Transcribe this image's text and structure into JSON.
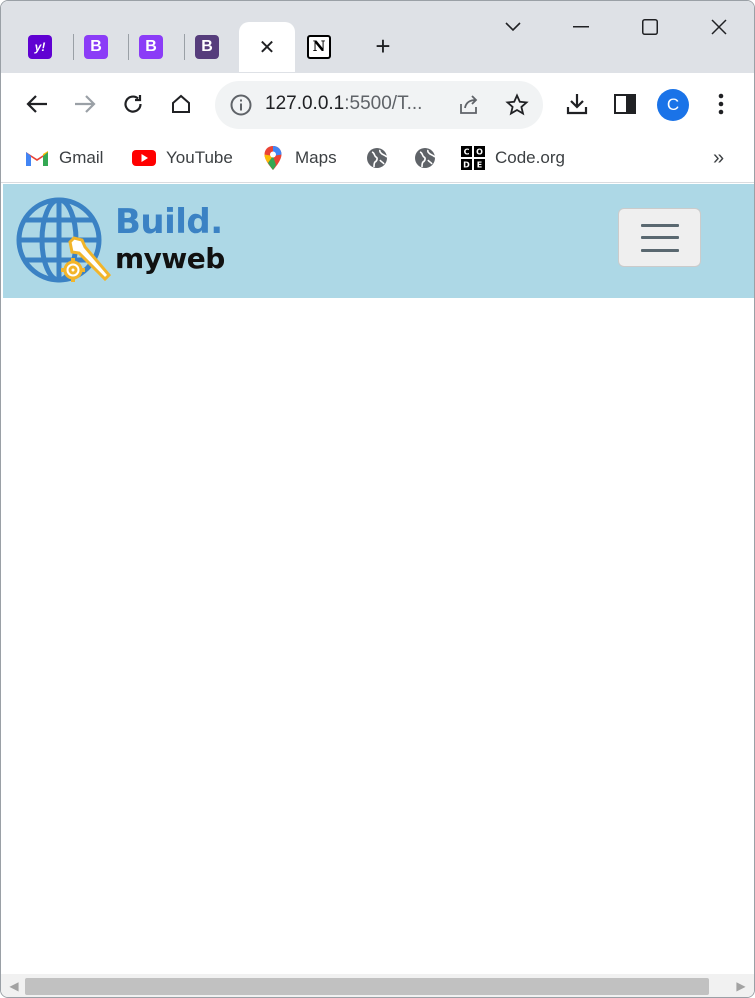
{
  "browser": {
    "tabs": [
      {
        "favicon": "yahoo-icon",
        "glyph": "y!"
      },
      {
        "favicon": "bootstrap-icon",
        "glyph": "B"
      },
      {
        "favicon": "bootstrap-icon",
        "glyph": "B"
      },
      {
        "favicon": "bootstrap-icon",
        "glyph": "B"
      },
      {
        "favicon": "close-icon",
        "glyph": "✕",
        "active": true
      },
      {
        "favicon": "notion-icon",
        "glyph": "N"
      }
    ],
    "new_tab_glyph": "+",
    "url_host": "127.0.0.1",
    "url_path": ":5500/T...",
    "profile_initial": "C",
    "bookmarks": [
      {
        "label": "Gmail",
        "icon": "gmail-icon"
      },
      {
        "label": "YouTube",
        "icon": "youtube-icon"
      },
      {
        "label": "Maps",
        "icon": "maps-icon"
      },
      {
        "label": "",
        "icon": "globe-icon"
      },
      {
        "label": "",
        "icon": "globe-icon"
      },
      {
        "label": "Code.org",
        "icon": "code-org-icon"
      }
    ],
    "more_bookmarks_glyph": "»"
  },
  "page": {
    "navbar_bg": "#add8e6",
    "brand_line1": "Build.",
    "brand_line2": "myweb",
    "brand_color": "#3b82c4"
  }
}
